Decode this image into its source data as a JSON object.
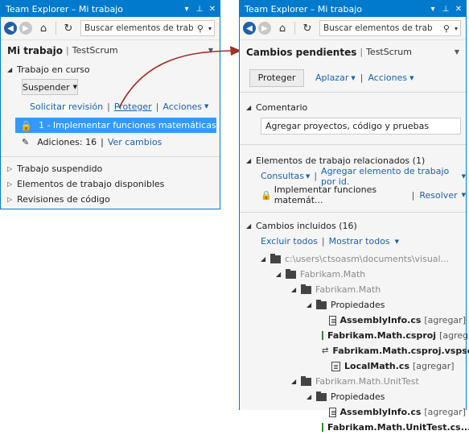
{
  "left": {
    "title": "Team Explorer – Mi trabajo",
    "search_placeholder": "Buscar elementos de trab",
    "header": {
      "title": "Mi trabajo",
      "project": "TestScrum"
    },
    "in_progress": {
      "label": "Trabajo en curso",
      "suspend_label": "Suspender",
      "links": [
        "Solicitar revisión",
        "Proteger",
        "Acciones"
      ],
      "work_item": "1 - Implementar funciones matemáticas",
      "changes_label": "Adiciones: 16",
      "view_changes": "Ver cambios"
    },
    "collapsed_sections": [
      "Trabajo suspendido",
      "Elementos de trabajo disponibles",
      "Revisiones de código"
    ]
  },
  "right": {
    "title": "Team Explorer – Mi trabajo",
    "search_placeholder": "Buscar elementos de trab",
    "header": {
      "title": "Cambios pendientes",
      "project": "TestScrum"
    },
    "actions": {
      "check_in": "Proteger",
      "shelve": "Aplazar",
      "actions": "Acciones"
    },
    "comment": {
      "label": "Comentario",
      "value": "Agregar proyectos, código y pruebas"
    },
    "related": {
      "label": "Elementos de trabajo relacionados (1)",
      "queries": "Consultas",
      "add_by_id": "Agregar elemento de trabajo por id.",
      "item": "Implementar funciones matemát...",
      "resolve": "Resolver"
    },
    "included": {
      "label": "Cambios incluidos (16)",
      "exclude_all": "Excluir todos",
      "show_all": "Mostrar todos",
      "tree": [
        {
          "text": "c:\\users\\ctsoasm\\documents\\visual...",
          "kind": "folder",
          "gray": true
        },
        {
          "text": "Fabrikam.Math",
          "kind": "folder",
          "gray": true
        },
        {
          "text": "Fabrikam.Math",
          "kind": "folder",
          "gray": true
        },
        {
          "text": "Propiedades",
          "kind": "folder",
          "gray": false
        },
        {
          "text": "AssemblyInfo.cs",
          "tag": "[agregar]",
          "kind": "file"
        },
        {
          "text": "Fabrikam.Math.csproj",
          "tag": "[agregar]",
          "kind": "project"
        },
        {
          "text": "Fabrikam.Math.csproj.vspscc...",
          "tag": "",
          "kind": "scc"
        },
        {
          "text": "LocalMath.cs",
          "tag": "[agregar]",
          "kind": "file"
        },
        {
          "text": "Fabrikam.Math.UnitTest",
          "kind": "folder",
          "gray": true
        },
        {
          "text": "Propiedades",
          "kind": "folder",
          "gray": false
        },
        {
          "text": "AssemblyInfo.cs",
          "tag": "[agregar]",
          "kind": "file"
        },
        {
          "text": "Fabrikam.Math.UnitTest.cs...",
          "tag": "",
          "kind": "project"
        }
      ]
    }
  },
  "colors": {
    "accent": "#007acc",
    "link": "#1c61a8",
    "selection": "#3399ff",
    "arrow": "#a0302a"
  }
}
